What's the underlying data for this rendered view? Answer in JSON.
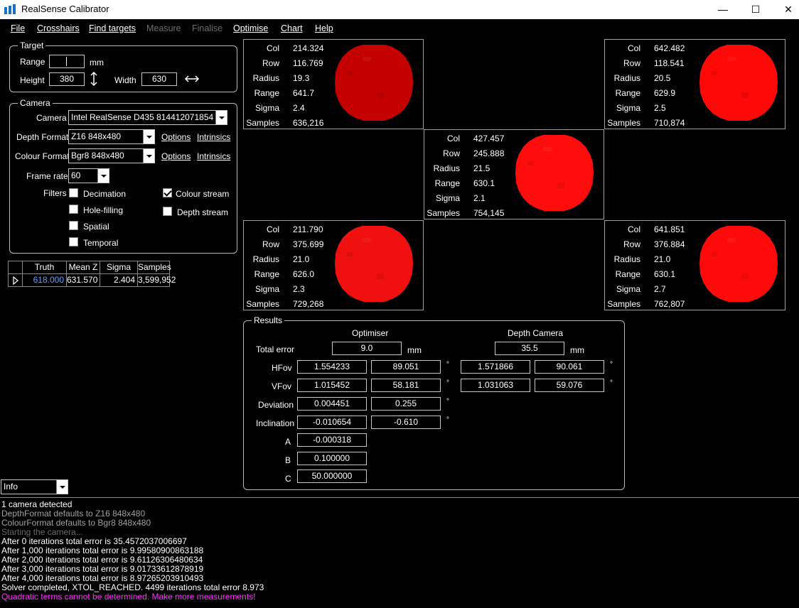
{
  "window": {
    "title": "RealSense Calibrator",
    "minimize": "—",
    "maximize": "☐",
    "close": "✕"
  },
  "menu": [
    {
      "label": "File",
      "enabled": true
    },
    {
      "label": "Crosshairs",
      "enabled": true
    },
    {
      "label": "Find targets",
      "enabled": true
    },
    {
      "label": "Measure",
      "enabled": false
    },
    {
      "label": "Finalise",
      "enabled": false
    },
    {
      "label": "Optimise",
      "enabled": true
    },
    {
      "label": "Chart",
      "enabled": true
    },
    {
      "label": "Help",
      "enabled": true
    }
  ],
  "target": {
    "group_title": "Target",
    "range_label": "Range",
    "range_value": "",
    "range_unit": "mm",
    "height_label": "Height",
    "height_value": "380",
    "width_label": "Width",
    "width_value": "630"
  },
  "camera": {
    "group_title": "Camera",
    "camera_label": "Camera",
    "camera_value": "Intel RealSense D435 814412071854",
    "depth_label": "Depth Format",
    "depth_value": "Z16 848x480",
    "colour_label": "Colour Format",
    "colour_value": "Bgr8 848x480",
    "options": "Options",
    "intrinsics": "Intrinsics",
    "framerate_label": "Frame rate",
    "framerate_value": "60",
    "filters_label": "Filters",
    "filters": [
      {
        "label": "Decimation",
        "checked": false
      },
      {
        "label": "Hole-filling",
        "checked": false
      },
      {
        "label": "Spatial",
        "checked": false
      },
      {
        "label": "Temporal",
        "checked": false
      }
    ],
    "streams": [
      {
        "label": "Colour stream",
        "checked": true
      },
      {
        "label": "Depth stream",
        "checked": false
      }
    ]
  },
  "grid": {
    "headers": [
      "Truth",
      "Mean Z",
      "Sigma",
      "Samples"
    ],
    "row": {
      "truth": "618.000",
      "mean_z": "631.570",
      "sigma": "2.404",
      "samples": "3,599,952"
    },
    "truth_color": "#5aa0ff"
  },
  "target_panels": [
    {
      "name": "top-left",
      "Col": "214.324",
      "Row": "116.769",
      "Radius": "19.3",
      "Range": "641.7",
      "Sigma": "2.4",
      "Samples": "636,216",
      "color": "#c40000"
    },
    {
      "name": "top-right",
      "Col": "642.482",
      "Row": "118.541",
      "Radius": "20.5",
      "Range": "629.9",
      "Sigma": "2.5",
      "Samples": "710,874",
      "color": "#ff0808"
    },
    {
      "name": "centre",
      "Col": "427.457",
      "Row": "245.888",
      "Radius": "21.5",
      "Range": "630.1",
      "Sigma": "2.1",
      "Samples": "754,145",
      "color": "#ff0d0d"
    },
    {
      "name": "bottom-left",
      "Col": "211.790",
      "Row": "375.699",
      "Radius": "21.0",
      "Range": "626.0",
      "Sigma": "2.3",
      "Samples": "729,268",
      "color": "#f01010"
    },
    {
      "name": "bottom-right",
      "Col": "641.851",
      "Row": "376.884",
      "Radius": "21.0",
      "Range": "630.1",
      "Sigma": "2.7",
      "Samples": "762,807",
      "color": "#ff0a0a"
    }
  ],
  "panel_keys": [
    "Col",
    "Row",
    "Radius",
    "Range",
    "Sigma",
    "Samples"
  ],
  "results": {
    "group_title": "Results",
    "optimiser_header": "Optimiser",
    "depth_camera_header": "Depth Camera",
    "total_error_label": "Total error",
    "total_error_opt": "9.0",
    "total_error_dc": "35.5",
    "unit_mm": "mm",
    "degree": "°",
    "hfov_label": "HFov",
    "hfov": [
      "1.554233",
      "89.051",
      "1.571866",
      "90.061"
    ],
    "vfov_label": "VFov",
    "vfov": [
      "1.015452",
      "58.181",
      "1.031063",
      "59.076"
    ],
    "deviation_label": "Deviation",
    "deviation": [
      "0.004451",
      "0.255"
    ],
    "inclination_label": "Inclination",
    "inclination": [
      "-0.010654",
      "-0.610"
    ],
    "a_label": "A",
    "a_value": "-0.000318",
    "b_label": "B",
    "b_value": "0.100000",
    "c_label": "C",
    "c_value": "50.000000"
  },
  "log_level": "Info",
  "log": [
    {
      "text": "1 camera detected",
      "color": "#ffffff"
    },
    {
      "text": "DepthFormat defaults to Z16 848x480",
      "color": "#a0a0a0"
    },
    {
      "text": "ColourFormat defaults to Bgr8 848x480",
      "color": "#a0a0a0"
    },
    {
      "text": "Starting the camera...",
      "color": "#6a6a6a"
    },
    {
      "text": "After 0 iterations total error is 35.4572037006697",
      "color": "#ffffff"
    },
    {
      "text": "After 1,000 iterations total error is 9.99580900863188",
      "color": "#ffffff"
    },
    {
      "text": "After 2,000 iterations total error is 9.61126306480634",
      "color": "#ffffff"
    },
    {
      "text": "After 3,000 iterations total error is 9.01733612878919",
      "color": "#ffffff"
    },
    {
      "text": "After 4,000 iterations total error is 8.97265203910493",
      "color": "#ffffff"
    },
    {
      "text": "Solver completed, XTOL_REACHED. 4499 iterations total error 8.973",
      "color": "#ffffff"
    },
    {
      "text": "Quadratic terms cannot be determined. Make more measurements!",
      "color": "#ff33ff"
    }
  ]
}
